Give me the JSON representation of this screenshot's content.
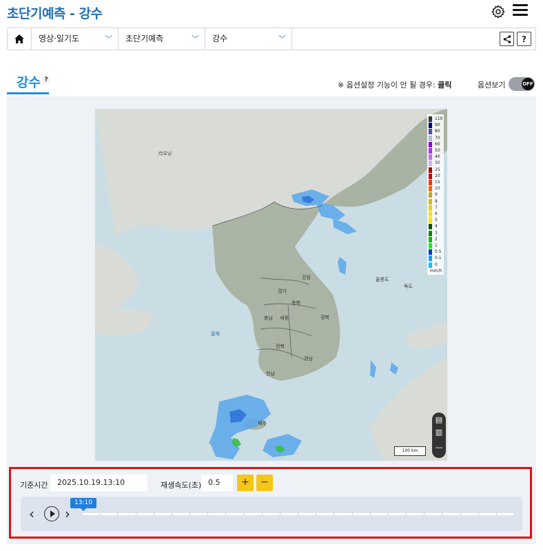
{
  "header": {
    "title": "초단기예측 - 강수",
    "settings_icon": "gear-icon",
    "menu_icon": "hamburger-icon"
  },
  "breadcrumb": {
    "home_icon": "home-icon",
    "items": [
      {
        "label": "영상·일기도"
      },
      {
        "label": "초단기예측"
      },
      {
        "label": "강수"
      }
    ],
    "share_icon": "share-icon",
    "help_label": "?"
  },
  "tab": {
    "title": "강수",
    "help_label": "?"
  },
  "options": {
    "note_prefix": "※ 옵션설정 기능이 안 될 경우:",
    "note_action": "클릭",
    "view_label": "옵션보기",
    "toggle_state": "OFF"
  },
  "map": {
    "labels": {
      "raoning": "라오닝",
      "gangwon": "강원",
      "gyeonggi": "경기",
      "chungbuk": "충북",
      "chungnam": "충남",
      "sejong": "세종",
      "gyeongbuk": "경북",
      "jeonbuk": "전북",
      "gyeongnam": "경남",
      "jeonnam": "전남",
      "yellow_sea": "황해",
      "ulleungdo": "울릉도",
      "dokdo": "독도",
      "jeju": "제주"
    },
    "scalebar": "100 km",
    "legend": {
      "unit": "mm/h",
      "levels": [
        {
          "value": "110",
          "color": "#333333"
        },
        {
          "value": "90",
          "color": "#000390"
        },
        {
          "value": "80",
          "color": "#4c4eb1"
        },
        {
          "value": "70",
          "color": "#b3b4de"
        },
        {
          "value": "60",
          "color": "#9300e4"
        },
        {
          "value": "50",
          "color": "#b329ff"
        },
        {
          "value": "40",
          "color": "#c969ff"
        },
        {
          "value": "30",
          "color": "#e0a9ff"
        },
        {
          "value": "25",
          "color": "#b40000"
        },
        {
          "value": "20",
          "color": "#d20000"
        },
        {
          "value": "15",
          "color": "#ff3200"
        },
        {
          "value": "10",
          "color": "#ff6600"
        },
        {
          "value": "9",
          "color": "#ccaa00"
        },
        {
          "value": "8",
          "color": "#e0b900"
        },
        {
          "value": "7",
          "color": "#f9cd00"
        },
        {
          "value": "6",
          "color": "#ffdc1f"
        },
        {
          "value": "5",
          "color": "#ffe100"
        },
        {
          "value": "4",
          "color": "#005a00"
        },
        {
          "value": "3",
          "color": "#008c00"
        },
        {
          "value": "2",
          "color": "#00be00"
        },
        {
          "value": "1",
          "color": "#00ff00"
        },
        {
          "value": "0.5",
          "color": "#0033f5"
        },
        {
          "value": "0.1",
          "color": "#00a3ff"
        },
        {
          "value": "0",
          "color": "#00c8ff"
        }
      ]
    }
  },
  "controls": {
    "base_time_label": "기준시간",
    "base_time_value": "2025.10.19.13:10",
    "speed_label": "재생속도(초)",
    "speed_value": "0.5",
    "plus_label": "+",
    "minus_label": "−",
    "current_time": "13:10",
    "progress": 0
  }
}
